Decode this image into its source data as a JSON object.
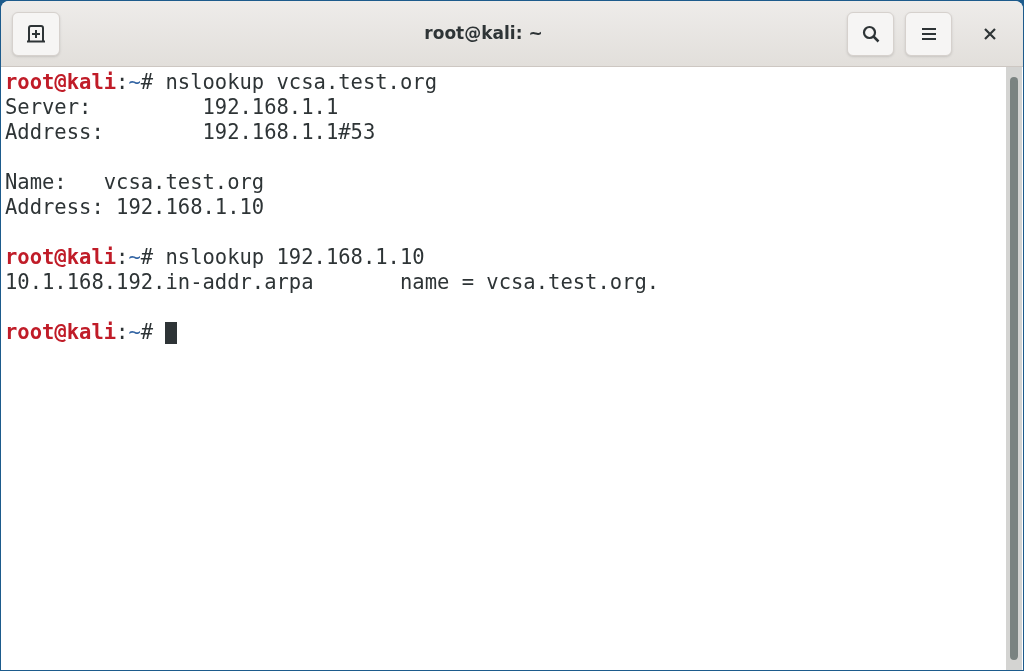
{
  "window": {
    "title": "root@kali: ~"
  },
  "terminal": {
    "lines": [
      {
        "kind": "prompt",
        "user": "root@kali",
        "separator": ":",
        "path": "~",
        "symbol": "#",
        "command": "nslookup vcsa.test.org",
        "cursor": false
      },
      {
        "kind": "output",
        "text": "Server:         192.168.1.1"
      },
      {
        "kind": "output",
        "text": "Address:        192.168.1.1#53"
      },
      {
        "kind": "blank"
      },
      {
        "kind": "output",
        "text": "Name:   vcsa.test.org"
      },
      {
        "kind": "output",
        "text": "Address: 192.168.1.10"
      },
      {
        "kind": "blank"
      },
      {
        "kind": "prompt",
        "user": "root@kali",
        "separator": ":",
        "path": "~",
        "symbol": "#",
        "command": "nslookup 192.168.1.10",
        "cursor": false
      },
      {
        "kind": "output",
        "text": "10.1.168.192.in-addr.arpa       name = vcsa.test.org."
      },
      {
        "kind": "blank"
      },
      {
        "kind": "prompt",
        "user": "root@kali",
        "separator": ":",
        "path": "~",
        "symbol": "#",
        "cursor": true
      }
    ]
  }
}
